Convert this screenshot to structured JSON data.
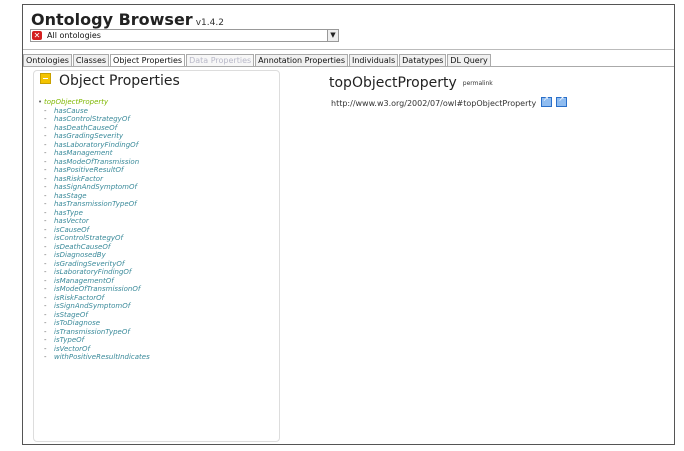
{
  "header": {
    "title": "Ontology Browser",
    "version": "v1.4.2",
    "ontology_select": {
      "value": "All ontologies"
    }
  },
  "tabs": [
    {
      "label": "Ontologies",
      "state": "normal"
    },
    {
      "label": "Classes",
      "state": "normal"
    },
    {
      "label": "Object Properties",
      "state": "active"
    },
    {
      "label": "Data Properties",
      "state": "disabled"
    },
    {
      "label": "Annotation Properties",
      "state": "normal"
    },
    {
      "label": "Individuals",
      "state": "normal"
    },
    {
      "label": "Datatypes",
      "state": "normal"
    },
    {
      "label": "DL Query",
      "state": "normal"
    }
  ],
  "left_panel": {
    "title": "Object Properties",
    "root": "topObjectProperty",
    "items": [
      "hasCause",
      "hasControlStrategyOf",
      "hasDeathCauseOf",
      "hasGradingSeverity",
      "hasLaboratoryFindingOf",
      "hasManagement",
      "hasModeOfTransmission",
      "hasPositiveResultOf",
      "hasRiskFactor",
      "hasSignAndSymptomOf",
      "hasStage",
      "hasTransmissionTypeOf",
      "hasType",
      "hasVector",
      "isCauseOf",
      "isControlStrategyOf",
      "isDeathCauseOf",
      "isDiagnosedBy",
      "isGradingSeverityOf",
      "isLaboratoryFindingOf",
      "isManagementOf",
      "isModeOfTransmissionOf",
      "isRiskFactorOf",
      "isSignAndSymptomOf",
      "isStageOf",
      "isToDiagnose",
      "isTransmissionTypeOf",
      "isTypeOf",
      "isVectorOf",
      "withPositiveResultIndicates"
    ]
  },
  "detail": {
    "title": "topObjectProperty",
    "permalink_label": "permalink",
    "uri": "http://www.w3.org/2002/07/owl#topObjectProperty"
  },
  "colors": {
    "root_item": "#7fb800",
    "property_item": "#3a8a9a",
    "close_icon": "#d42020",
    "panel_icon": "#f3c300"
  }
}
